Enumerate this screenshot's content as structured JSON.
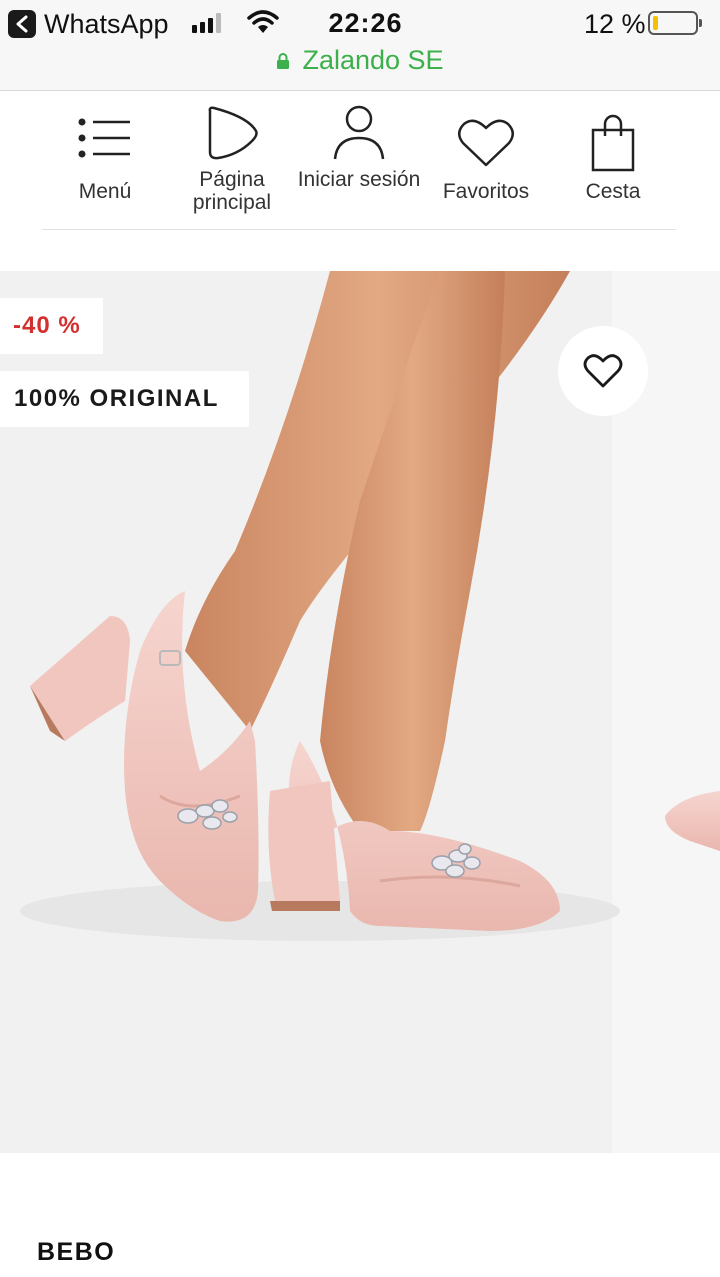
{
  "status_bar": {
    "back_app": "WhatsApp",
    "time": "22:26",
    "battery_text": "12 %",
    "battery_level": 0.12,
    "url_domain": "Zalando SE"
  },
  "nav": {
    "items": [
      {
        "label": "Menú",
        "icon": "menu-list-icon"
      },
      {
        "label": "Página principal",
        "icon": "home-logo-icon"
      },
      {
        "label": "Iniciar sesión",
        "icon": "user-icon"
      },
      {
        "label": "Favoritos",
        "icon": "heart-icon"
      },
      {
        "label": "Cesta",
        "icon": "bag-icon"
      }
    ]
  },
  "product": {
    "discount_badge": "-40 %",
    "authenticity_badge": "100% ORIGINAL",
    "favorite_icon": "heart-outline-icon",
    "brand": "BEBO",
    "image": "pink-block-heel-slingback-shoes-with-jewel-brooch"
  },
  "colors": {
    "secure_green": "#3cb04a",
    "discount_red": "#d32f2f",
    "shoe_pink": "#f1c6c0",
    "skin": "#d99c74"
  }
}
